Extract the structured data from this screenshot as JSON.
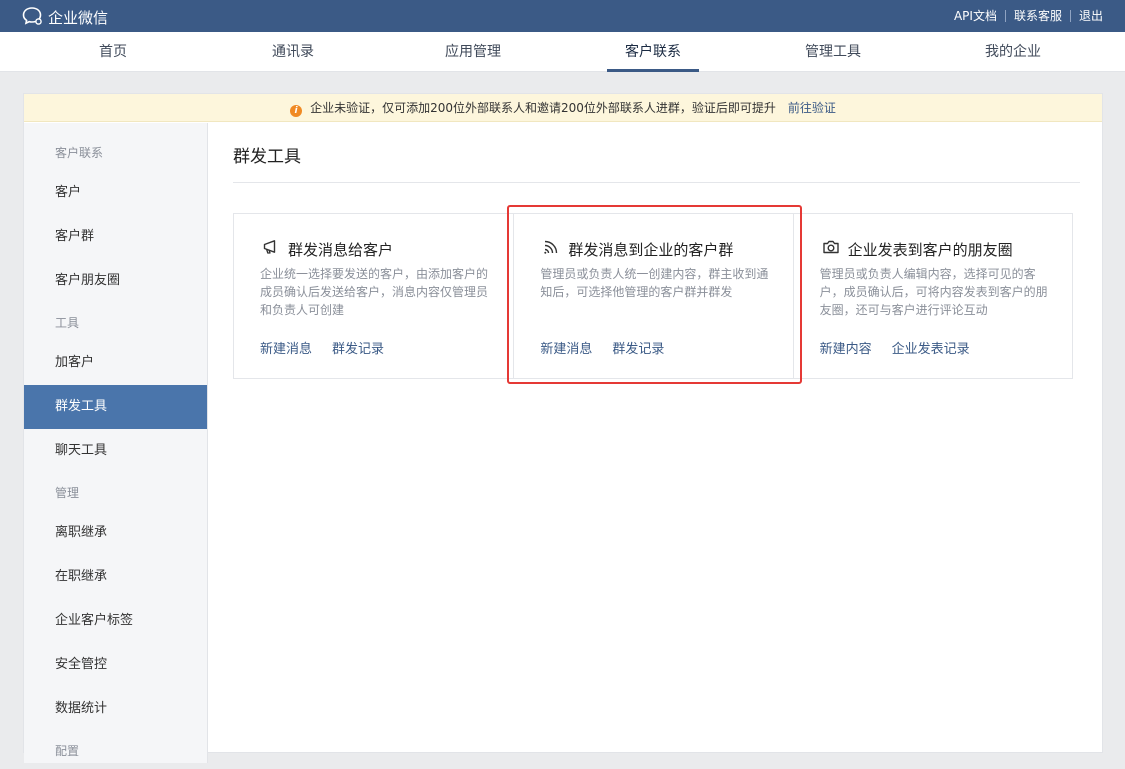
{
  "topbar": {
    "brand": "企业微信",
    "links": [
      "API文档",
      "联系客服",
      "退出"
    ]
  },
  "nav": {
    "tabs": [
      "首页",
      "通讯录",
      "应用管理",
      "客户联系",
      "管理工具",
      "我的企业"
    ],
    "active": "客户联系"
  },
  "notice": {
    "text": "企业未验证，仅可添加200位外部联系人和邀请200位外部联系人进群，验证后即可提升",
    "link": "前往验证"
  },
  "sidebar": {
    "groups": [
      {
        "label": "客户联系",
        "items": [
          "客户",
          "客户群",
          "客户朋友圈"
        ]
      },
      {
        "label": "工具",
        "items": [
          "加客户",
          "群发工具",
          "聊天工具"
        ]
      },
      {
        "label": "管理",
        "items": [
          "离职继承",
          "在职继承",
          "企业客户标签",
          "安全管控",
          "数据统计"
        ]
      },
      {
        "label": "配置",
        "items": []
      }
    ],
    "active": "群发工具"
  },
  "page": {
    "title": "群发工具"
  },
  "tools": [
    {
      "icon": "megaphone-icon",
      "title": "群发消息给客户",
      "desc": "企业统一选择要发送的客户，由添加客户的成员确认后发送给客户，消息内容仅管理员和负责人可创建",
      "links": [
        "新建消息",
        "群发记录"
      ]
    },
    {
      "icon": "broadcast-icon",
      "title": "群发消息到企业的客户群",
      "desc": "管理员或负责人统一创建内容，群主收到通知后，可选择他管理的客户群并群发",
      "links": [
        "新建消息",
        "群发记录"
      ]
    },
    {
      "icon": "camera-icon",
      "title": "企业发表到客户的朋友圈",
      "desc": "管理员或负责人编辑内容，选择可见的客户，成员确认后，可将内容发表到客户的朋友圈，还可与客户进行评论互动",
      "links": [
        "新建内容",
        "企业发表记录"
      ]
    }
  ],
  "colors": {
    "topbar": "#3b5a86",
    "accent": "#4a75ab",
    "link": "#3b5a86",
    "highlight": "#e53935",
    "notice_bg": "#fdf6dc"
  }
}
